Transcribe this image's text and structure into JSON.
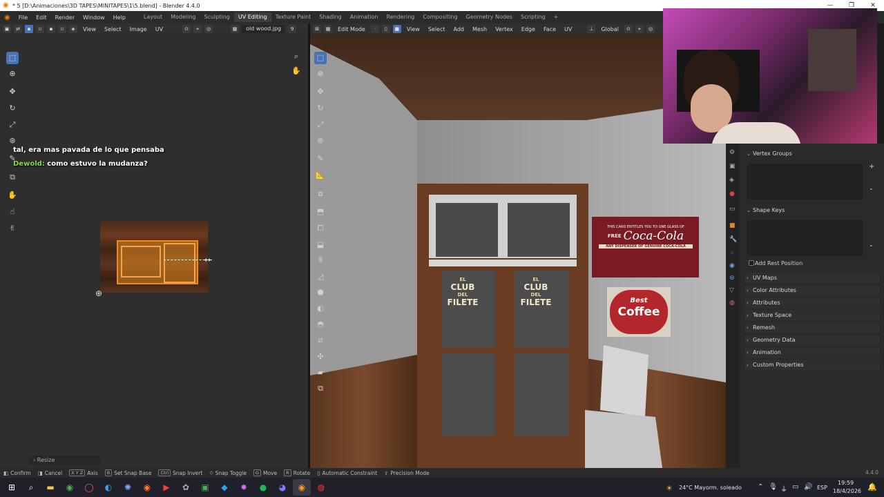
{
  "window": {
    "title": "* 5 [D:\\Animaciones\\3D TAPES\\MINITAPES\\1\\5.blend] - Blender 4.4.0",
    "controls": {
      "minimize": "—",
      "maximize": "❐",
      "close": "✕"
    }
  },
  "menu": {
    "items": [
      "File",
      "Edit",
      "Render",
      "Window",
      "Help"
    ],
    "workspaces": [
      "Layout",
      "Modeling",
      "Sculpting",
      "UV Editing",
      "Texture Paint",
      "Shading",
      "Animation",
      "Rendering",
      "Compositing",
      "Geometry Nodes",
      "Scripting"
    ],
    "active_workspace": "UV Editing",
    "add_workspace": "+"
  },
  "uv_editor": {
    "header": {
      "view": "View",
      "select": "Select",
      "image": "Image",
      "uv": "UV",
      "image_name": "old wood.jpg",
      "image_users": "9"
    },
    "chat": [
      {
        "name": "",
        "text": "tal, era mas pavada de lo que pensaba"
      },
      {
        "name": "Dewold:",
        "text": "como estuvo la mudanza?"
      }
    ],
    "operator_panel": "Resize"
  },
  "viewport": {
    "header": {
      "mode": "Edit Mode",
      "view": "View",
      "select": "Select",
      "add": "Add",
      "mesh": "Mesh",
      "vertex": "Vertex",
      "edge": "Edge",
      "face": "Face",
      "uv": "UV",
      "orientation": "Global"
    }
  },
  "scene_signs": {
    "club_line1": "EL",
    "club_line2": "CLUB",
    "club_line3": "DEL",
    "club_line4": "FILETE",
    "coke_top": "THIS CARD ENTITLES YOU TO ONE GLASS OF",
    "coke_free": "FREE",
    "coke_logo": "Coca-Cola",
    "coke_bottom": "ANY DISPENSER OF GENUINE COCA-COLA",
    "coffee_line1": "Best",
    "coffee_line2": "Coffee"
  },
  "properties": {
    "vertex_groups": "Vertex Groups",
    "shape_keys": "Shape Keys",
    "add_rest_position": "Add Rest Position",
    "panels": [
      "UV Maps",
      "Color Attributes",
      "Attributes",
      "Texture Space",
      "Remesh",
      "Geometry Data",
      "Animation",
      "Custom Properties"
    ]
  },
  "status_bar": {
    "items": [
      {
        "key": "",
        "label": "Confirm"
      },
      {
        "key": "",
        "label": "Cancel"
      },
      {
        "key": "X Y Z",
        "label": "Axis"
      },
      {
        "key": "B",
        "label": "Set Snap Base"
      },
      {
        "key": "Ctrl",
        "label": "Snap Invert"
      },
      {
        "key": "",
        "label": "Snap Toggle"
      },
      {
        "key": "G",
        "label": "Move"
      },
      {
        "key": "R",
        "label": "Rotate"
      },
      {
        "key": "",
        "label": "Automatic Constraint"
      },
      {
        "key": "",
        "label": "Precision Mode"
      }
    ],
    "version": "4.4.0"
  },
  "taskbar": {
    "weather": "24°C  Mayorm. soleado",
    "lang": "ESP",
    "time": "19:59",
    "date": "18/4/2026"
  },
  "colors": {
    "accent": "#4772b3",
    "uv_selection": "#f08a18",
    "chat_name": "#7ddc3c"
  }
}
